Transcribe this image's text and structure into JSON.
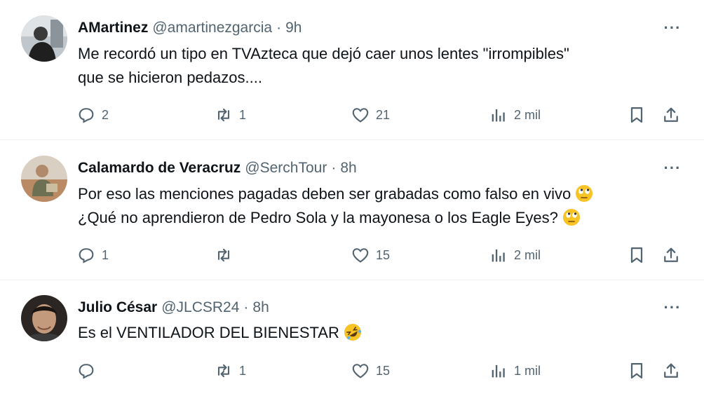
{
  "tweets": [
    {
      "name": "AMartinez",
      "handle": "@amartinezgarcia",
      "separator": "·",
      "time": "9h",
      "lines": [
        "Me recordó un tipo en TVAzteca que dejó caer unos lentes \"irrompibles\"",
        "que se hicieron pedazos...."
      ],
      "replies": "2",
      "retweets": "1",
      "likes": "21",
      "views": "2 mil"
    },
    {
      "name": "Calamardo de Veracruz",
      "handle": "@SerchTour",
      "separator": "·",
      "time": "8h",
      "lines": [
        "Por eso las menciones pagadas deben ser grabadas como falso en vivo",
        "¿Qué no aprendieron de Pedro Sola y la mayonesa o los Eagle Eyes?"
      ],
      "emojis": [
        "face-with-rolling-eyes",
        "face-with-rolling-eyes"
      ],
      "replies": "1",
      "retweets": "",
      "likes": "15",
      "views": "2 mil"
    },
    {
      "name": "Julio César",
      "handle": "@JLCSR24",
      "separator": "·",
      "time": "8h",
      "lines": [
        "Es el VENTILADOR DEL BIENESTAR"
      ],
      "emojis": [
        "rolling-on-the-floor-laughing"
      ],
      "replies": "",
      "retweets": "1",
      "likes": "15",
      "views": "1 mil"
    }
  ],
  "more_label": "···",
  "colors": {
    "text": "#0f1419",
    "secondary": "#536471",
    "divider": "#eff3f4",
    "emoji": "#f7c325"
  }
}
